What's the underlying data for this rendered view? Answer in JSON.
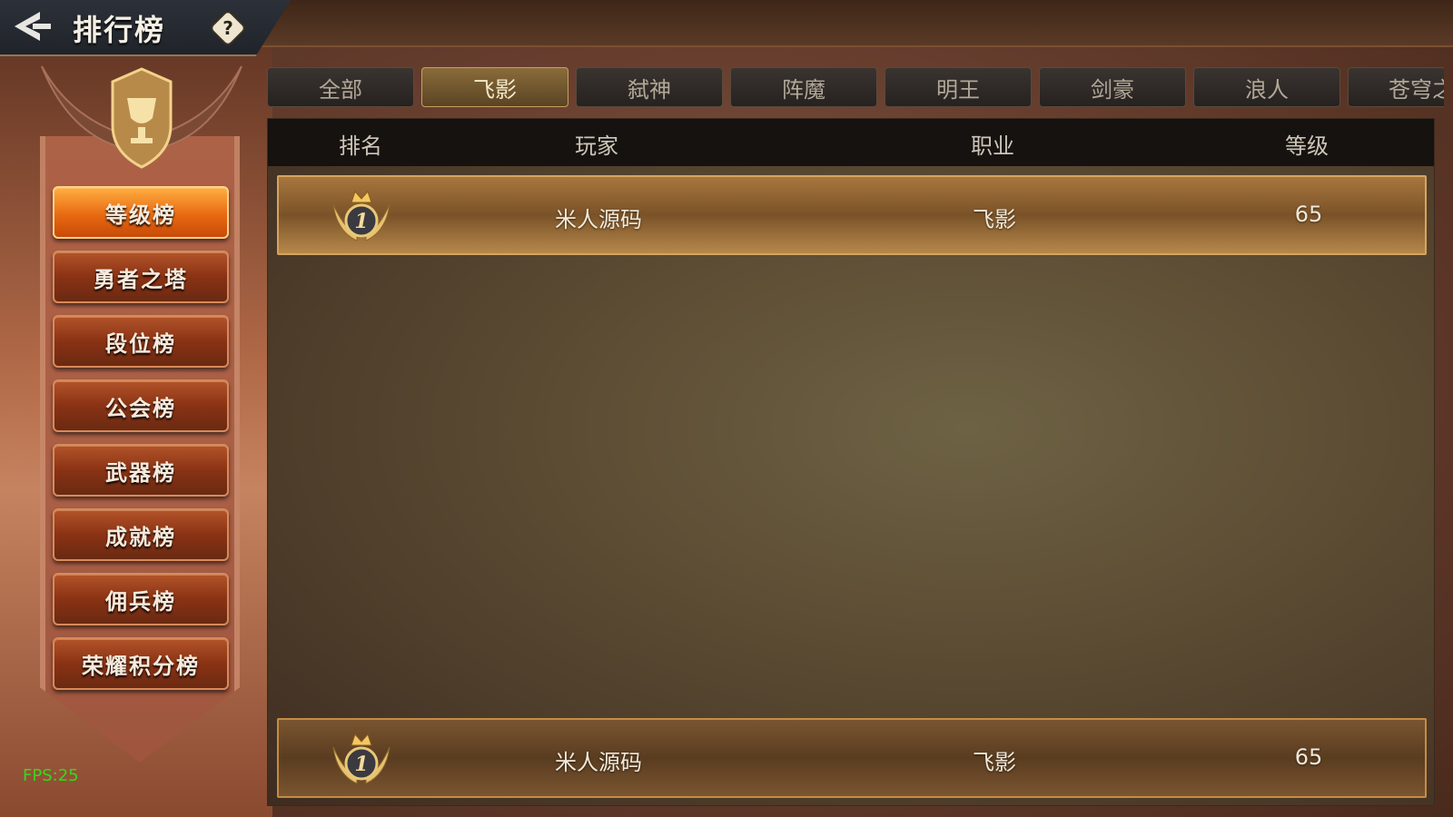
{
  "header": {
    "title": "排行榜",
    "help_symbol": "?"
  },
  "side_nav": [
    {
      "label": "等级榜",
      "active": true
    },
    {
      "label": "勇者之塔",
      "active": false
    },
    {
      "label": "段位榜",
      "active": false
    },
    {
      "label": "公会榜",
      "active": false
    },
    {
      "label": "武器榜",
      "active": false
    },
    {
      "label": "成就榜",
      "active": false
    },
    {
      "label": "佣兵榜",
      "active": false
    },
    {
      "label": "荣耀积分榜",
      "active": false
    }
  ],
  "tabs": [
    {
      "label": "全部",
      "active": false
    },
    {
      "label": "飞影",
      "active": true
    },
    {
      "label": "弑神",
      "active": false
    },
    {
      "label": "阵魔",
      "active": false
    },
    {
      "label": "明王",
      "active": false
    },
    {
      "label": "剑豪",
      "active": false
    },
    {
      "label": "浪人",
      "active": false
    },
    {
      "label": "苍穹之",
      "active": false
    }
  ],
  "table": {
    "columns": [
      "排名",
      "玩家",
      "职业",
      "等级"
    ],
    "rows": [
      {
        "rank": "1",
        "player": "米人源码",
        "class": "飞影",
        "level": "65"
      }
    ],
    "my_row": {
      "rank": "1",
      "player": "米人源码",
      "class": "飞影",
      "level": "65"
    }
  },
  "fps_text": "FPS:25",
  "colors": {
    "accent_orange": "#e86a12",
    "gold_border": "#d6a460",
    "fps_green": "#3ad61c"
  }
}
